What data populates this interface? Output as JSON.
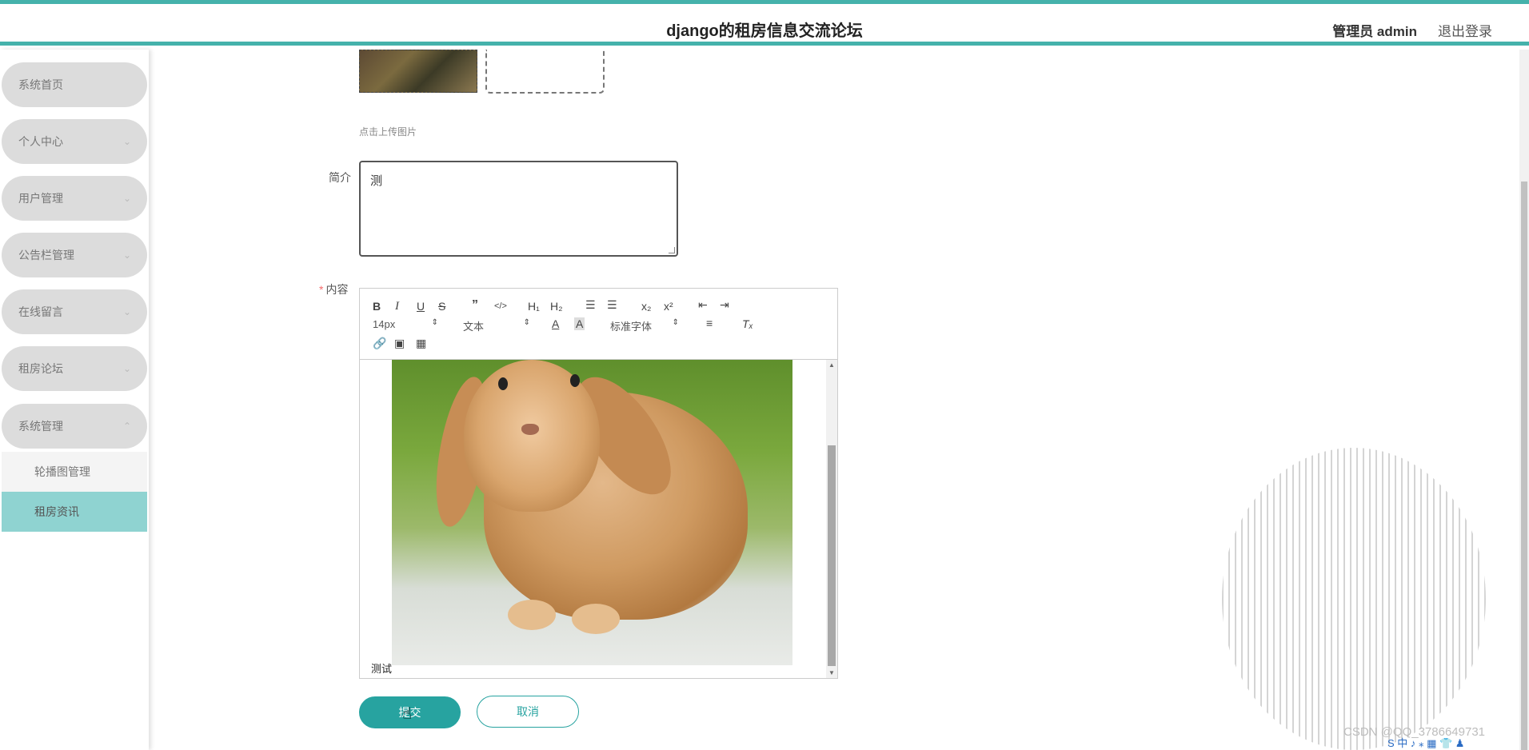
{
  "header": {
    "title": "django的租房信息交流论坛",
    "user": "管理员 admin",
    "logout": "退出登录"
  },
  "sidebar": {
    "items": [
      {
        "label": "系统首页"
      },
      {
        "label": "个人中心"
      },
      {
        "label": "用户管理"
      },
      {
        "label": "公告栏管理"
      },
      {
        "label": "在线留言"
      },
      {
        "label": "租房论坛"
      },
      {
        "label": "系统管理"
      }
    ],
    "sub_items": [
      {
        "label": "轮播图管理"
      },
      {
        "label": "租房资讯"
      }
    ]
  },
  "form": {
    "upload_tip": "点击上传图片",
    "intro_label": "简介",
    "intro_value": "测",
    "content_label": "内容",
    "content_text": "测试",
    "submit": "提交",
    "cancel": "取消"
  },
  "toolbar": {
    "size": "14px",
    "header": "文本",
    "font": "标准字体",
    "h1": "H₁",
    "h2": "H₂",
    "sub": "x₂",
    "sup": "x²"
  },
  "watermark": "CSDN @QQ_3786649731",
  "tray": "S 中 ♪ ⁎ ▦ 👕 ♟"
}
